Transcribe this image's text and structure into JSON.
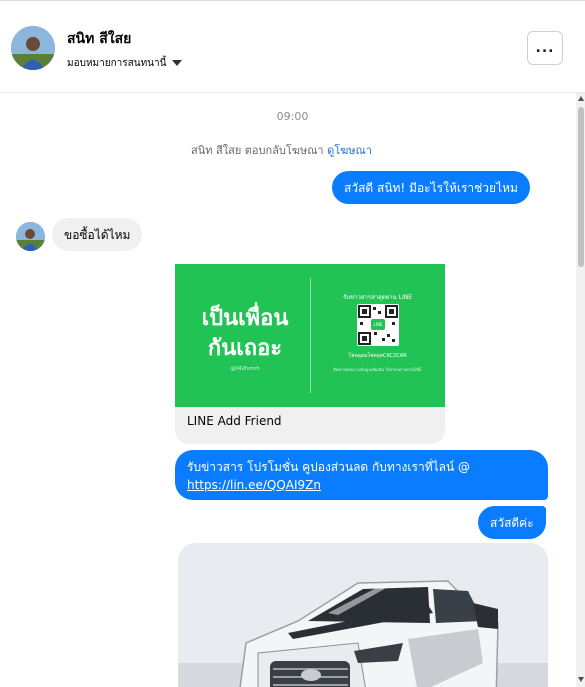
{
  "header": {
    "contact_name": "สนิท สีใสย",
    "assign_label": "มอบหมายการสนทนานี้",
    "more_label": "..."
  },
  "chat": {
    "timestamp": "09:00",
    "ad_reply_text": "สนิท สีใสย ตอบกลับโฆษณา",
    "ad_reply_link": "ดูโฆษณา",
    "messages": {
      "m1": "สวัสดี สนิท! มีอะไรให้เราช่วยไหม",
      "m2": "ขอซื้อได้ไหม",
      "m4_text": "รับข่าวสาร โปรโมชั่น คูปองส่วนลด กับทางเราที่ไลน์ @",
      "m4_link": "https://lin.ee/QQAI9Zn",
      "m5": "สวัสดีค่ะ"
    },
    "line_card": {
      "big_text_1": "เป็นเพื่อน",
      "big_text_2": "กันเถอะ",
      "handle": "@042fvmrh",
      "right_title": "รับข่าวสารล่าสุดผ่าน LINE",
      "qr_label": "LINE",
      "right_sub": "โชคอุดมโชคยุคCKC2CAR",
      "right_note": "ติดตามสอบถามข้อมูลเพิ่มเติม ได้ง่ายๆผ่านทางLINE",
      "title": "LINE Add Friend"
    }
  },
  "colors": {
    "accent": "#0a7cff",
    "line_green": "#21c355",
    "incoming": "#f0f0f0"
  }
}
